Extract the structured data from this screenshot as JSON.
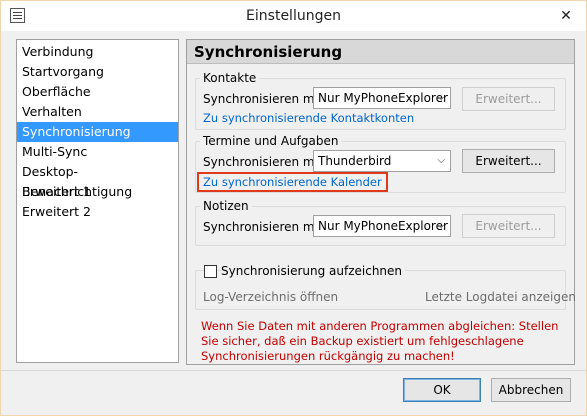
{
  "window": {
    "title": "Einstellungen",
    "close_glyph": "✕"
  },
  "nav": {
    "items": [
      {
        "label": "Verbindung"
      },
      {
        "label": "Startvorgang"
      },
      {
        "label": "Oberfläche"
      },
      {
        "label": "Verhalten"
      },
      {
        "label": "Synchronisierung",
        "selected": true
      },
      {
        "label": "Multi-Sync"
      },
      {
        "label": "Desktop-Benachrichtigung"
      },
      {
        "label": "Erweitert 1"
      },
      {
        "label": "Erweitert 2"
      }
    ]
  },
  "panel": {
    "header": "Synchronisierung",
    "contacts": {
      "group_label": "Kontakte",
      "sync_label": "Synchronisieren mit",
      "select_value": "Nur MyPhoneExplorer",
      "advanced_label": "Erweitert...",
      "link": "Zu synchronisierende Kontaktkonten"
    },
    "calendar": {
      "group_label": "Termine und Aufgaben",
      "sync_label": "Synchronisieren mit",
      "select_value": "Thunderbird",
      "advanced_label": "Erweitert...",
      "link": "Zu synchronisierende Kalender"
    },
    "notes": {
      "group_label": "Notizen",
      "sync_label": "Synchronisieren mit",
      "select_value": "Nur MyPhoneExplorer",
      "advanced_label": "Erweitert..."
    },
    "logging": {
      "checkbox_label": "Synchronisierung aufzeichnen",
      "checked": false,
      "open_dir": "Log-Verzeichnis öffnen",
      "show_last": "Letzte Logdatei anzeigen"
    },
    "warning": "Wenn Sie Daten mit anderen Programmen abgleichen: Stellen Sie sicher, daß ein Backup existiert um fehlgeschlagene Synchronisierungen rückgängig zu machen!"
  },
  "footer": {
    "ok_label": "OK",
    "cancel_label": "Abbrechen"
  },
  "colors": {
    "selection": "#3399ff",
    "link": "#0066cc",
    "warning": "#c00000",
    "highlight_box": "#e03a1a"
  }
}
